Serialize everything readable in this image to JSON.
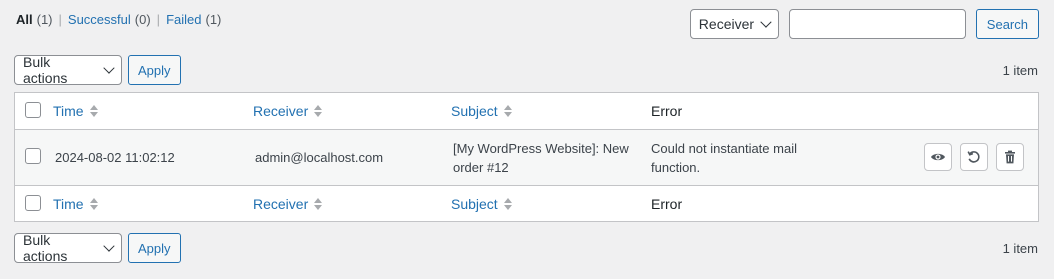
{
  "filters": {
    "all_label": "All",
    "all_count": "(1)",
    "successful_label": "Successful",
    "successful_count": "(0)",
    "failed_label": "Failed",
    "failed_count": "(1)",
    "separator": "|"
  },
  "search": {
    "field_select": "Receiver",
    "input_value": "",
    "button_label": "Search"
  },
  "tablenav_top": {
    "bulk_label": "Bulk actions",
    "apply_label": "Apply",
    "items_count": "1 item"
  },
  "tablenav_bottom": {
    "bulk_label": "Bulk actions",
    "apply_label": "Apply",
    "items_count": "1 item"
  },
  "columns": {
    "time": "Time",
    "receiver": "Receiver",
    "subject": "Subject",
    "error": "Error"
  },
  "rows": [
    {
      "time": "2024-08-02 11:02:12",
      "receiver": "admin@localhost.com",
      "subject_line1": "[My WordPress Website]: New",
      "subject_line2": "order #12",
      "error_line1": "Could not instantiate mail",
      "error_line2": "function.",
      "actions": [
        "eye-icon",
        "resend-icon",
        "trash-icon"
      ]
    }
  ],
  "colors": {
    "link": "#2271b1",
    "background": "#f0f0f1",
    "border": "#c3c4c7"
  }
}
